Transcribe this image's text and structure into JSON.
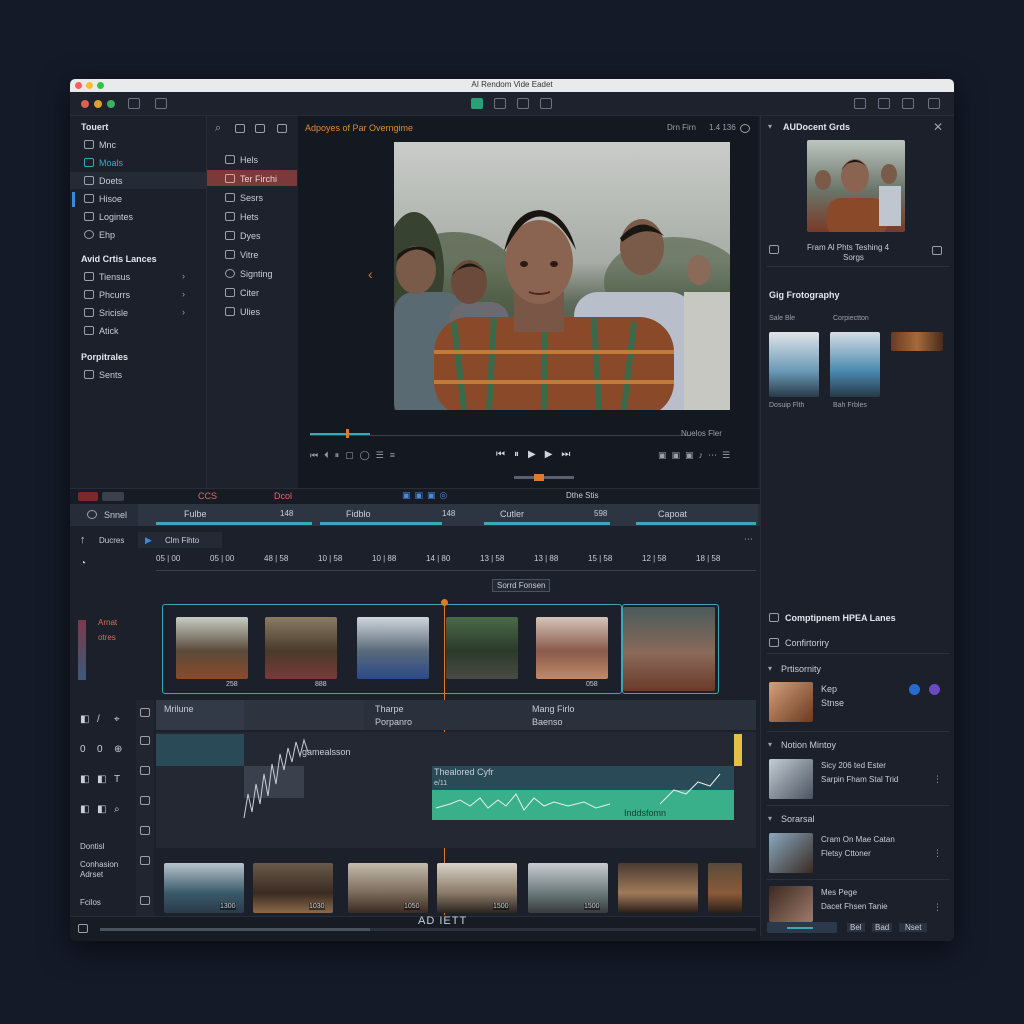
{
  "window": {
    "title": "AI Rendom Vide Eadet"
  },
  "sidebar": {
    "section1_title": "Touert",
    "items": [
      {
        "label": "Mnc"
      },
      {
        "label": "Moals"
      },
      {
        "label": "Doets"
      },
      {
        "label": "Hisoe"
      },
      {
        "label": "Logintes"
      },
      {
        "label": "Ehp"
      }
    ],
    "section2_title": "Avid Crtis Lances",
    "items2": [
      {
        "label": "Tiensus"
      },
      {
        "label": "Phcurrs"
      },
      {
        "label": "Sricisle"
      },
      {
        "label": "Atick"
      }
    ],
    "section3_title": "Porpitrales",
    "items3": [
      {
        "label": "Sents"
      }
    ]
  },
  "subpanel": {
    "items": [
      {
        "label": "Hels"
      },
      {
        "label": "Ter Firchi"
      },
      {
        "label": "Sesrs"
      },
      {
        "label": "Hets"
      },
      {
        "label": "Dyes"
      },
      {
        "label": "Vitre"
      },
      {
        "label": "Signting"
      },
      {
        "label": "Citer"
      },
      {
        "label": "Ulies"
      }
    ]
  },
  "viewer": {
    "title": "Adpoyes of Par Overngime",
    "meta": "Drn Firn",
    "meta2": "1.4 136",
    "scrub_label": "Nuelos Fler"
  },
  "inspector": {
    "title": "AUDocent Grds",
    "caption": "Fram Al Phts Teshing 4",
    "caption2": "Sorgs",
    "section_title": "Gig Frotography",
    "thumbs": [
      {
        "title": "Sale Ble",
        "caption": "Dosuip Flth"
      },
      {
        "title": "Corpiectton",
        "caption": "Bah Frbles"
      }
    ],
    "list_title": "Comptipnem HPEA Lanes",
    "list_subtitle": "Confirtoriry",
    "groups": [
      {
        "header": "Prtisornity",
        "title": "Kep",
        "sub": "Stnse"
      },
      {
        "header": "Notion Mintoy",
        "title": "Sicy 206 ted Ester",
        "sub": "Sarpin Fham Stal Trid"
      },
      {
        "header": "Sorarsal",
        "title": "Cram On Mae Catan",
        "sub": "Fletsy Cttoner"
      },
      {
        "header": "",
        "title": "Mes Pege",
        "sub": "Dacet Fhsen Tanie"
      }
    ],
    "bottom_buttons": [
      "Bel",
      "Bad",
      "Nset"
    ]
  },
  "timeline": {
    "tab_label": "Snnel",
    "tracks_header": [
      {
        "label": "Fulbe",
        "num": "148"
      },
      {
        "label": "Fidblo",
        "num": "148"
      },
      {
        "label": "Cutler",
        "num": "598"
      },
      {
        "label": "Capoat",
        "num": ""
      }
    ],
    "seq_label": "Ducres",
    "seq_name": "Clm Fihto",
    "ruler": [
      "05 | 00",
      "05 | 00",
      "48 | 58",
      "10 | 58",
      "10 | 88",
      "14 | 80",
      "13 | 58",
      "13 | 88",
      "15 | 58",
      "12 | 58",
      "18 | 58"
    ],
    "sort_label": "Sorrd Fonsen",
    "track_labels": [
      "Arnat",
      "otres"
    ],
    "audio_tracks": [
      {
        "label": "Mrilune",
        "title": "Tharpe",
        "title2": "Porpanro",
        "title3": "Mang Firlo",
        "title4": "Baenso"
      },
      {
        "label": "gamealsson",
        "title": "Thealored Cyfr",
        "sub": "e/11",
        "wave_label": "Inddsfomn"
      }
    ],
    "left_labels": [
      "Dontisl",
      "Conhasion",
      "Adrset",
      "Fcilos"
    ],
    "bottom_label": "AD IETT",
    "clip_durations": [
      "258",
      "888",
      "",
      "",
      "058",
      ""
    ],
    "film_durations": [
      "1300",
      "1030",
      "1050",
      "1500",
      "1500",
      ""
    ]
  },
  "status_bar": {
    "center": "Dthe Stis",
    "left": "CCS",
    "left2": "Dcol"
  },
  "colors": {
    "accent": "#3aa8b8",
    "selection": "#7a3a3a",
    "orange": "#e07a2a",
    "green": "#3ab08a",
    "bg": "#1b202b"
  }
}
